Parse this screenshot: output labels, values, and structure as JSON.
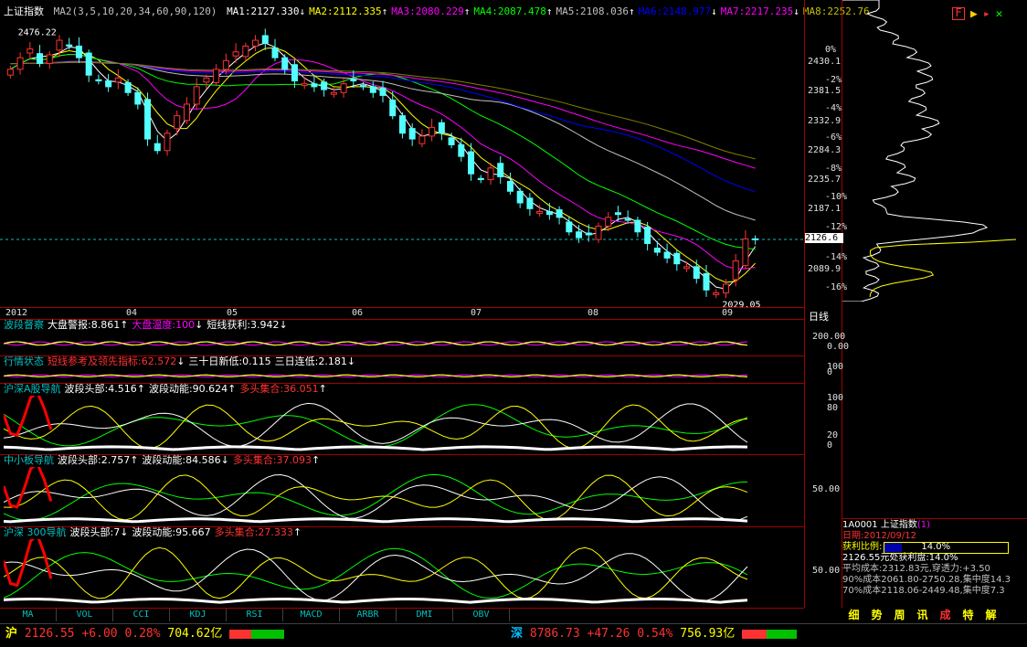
{
  "colors": {
    "up": "#ff3232",
    "down": "#54ffff",
    "ma1": "#ffffff",
    "ma2": "#ffff00",
    "ma3": "#ff00ff",
    "ma4": "#00ff00",
    "ma5": "#c0c0c0",
    "ma6": "#0000ff",
    "ma7": "#ff00ff",
    "ma8": "#808000"
  },
  "header": {
    "title": "上证指数",
    "ma_params": "MA2(3,5,10,20,34,60,90,120)",
    "ma": [
      {
        "label": "MA1:2127.330",
        "arrow": "↓",
        "color": "#ffffff"
      },
      {
        "label": "MA2:2112.335",
        "arrow": "↑",
        "color": "#ffff00"
      },
      {
        "label": "MA3:2080.229",
        "arrow": "↑",
        "color": "#ff00ff"
      },
      {
        "label": "MA4:2087.478",
        "arrow": "↑",
        "color": "#00ff00"
      },
      {
        "label": "MA5:2108.036",
        "arrow": "↑",
        "color": "#c0c0c0"
      },
      {
        "label": "MA6:2148.977",
        "arrow": "↓",
        "color": "#0000ff"
      },
      {
        "label": "MA7:2217.235",
        "arrow": "↓",
        "color": "#ff00ff"
      },
      {
        "label": "MA8:2252.76",
        "arrow": "",
        "color": "#c0c000"
      }
    ]
  },
  "chart_data": {
    "type": "candlestick",
    "title": "上证指数",
    "high_label": "2476.22",
    "low_label": "2029.05",
    "last_price": "2126.6",
    "ylim": [
      2020,
      2500
    ],
    "y_ticks": [
      "2430.1",
      "2381.5",
      "2332.9",
      "2284.3",
      "2235.7",
      "2187.1",
      "2089.9"
    ],
    "pct_ticks": [
      "0%",
      "-2%",
      "-4%",
      "-6%",
      "-8%",
      "-10%",
      "-12%",
      "-14%",
      "-16%"
    ],
    "x_labels": [
      "2012",
      "04",
      "05",
      "06",
      "07",
      "08",
      "09"
    ],
    "period": "日线",
    "series_close": [
      2420,
      2440,
      2455,
      2430,
      2445,
      2470,
      2460,
      2440,
      2410,
      2400,
      2390,
      2405,
      2380,
      2360,
      2300,
      2280,
      2310,
      2340,
      2360,
      2390,
      2405,
      2420,
      2435,
      2450,
      2460,
      2470,
      2465,
      2440,
      2420,
      2400,
      2395,
      2390,
      2385,
      2380,
      2395,
      2400,
      2390,
      2380,
      2375,
      2340,
      2310,
      2300,
      2305,
      2320,
      2310,
      2290,
      2270,
      2240,
      2230,
      2250,
      2235,
      2210,
      2190,
      2180,
      2175,
      2170,
      2165,
      2140,
      2130,
      2135,
      2150,
      2165,
      2170,
      2160,
      2140,
      2120,
      2105,
      2095,
      2085,
      2080,
      2060,
      2040,
      2035,
      2050,
      2090,
      2128,
      2127
    ]
  },
  "indicators": [
    {
      "name": "波段督察",
      "items": [
        {
          "label": "大盘警报:8.861",
          "arrow": "↑",
          "color": "#ffffff"
        },
        {
          "label": "大盘温度:100",
          "arrow": "↓",
          "color": "#ff00ff"
        },
        {
          "label": "短线获利:3.942",
          "arrow": "↓",
          "color": "#ffffff"
        }
      ],
      "ticks": [
        "200.00",
        "0.00"
      ]
    },
    {
      "name": "行情状态",
      "items": [
        {
          "label": "短线参考及领先指标:62.572",
          "arrow": "↓",
          "color": "#ff3232"
        },
        {
          "label": "三十日新低:0.115",
          "arrow": "",
          "color": "#ffffff"
        },
        {
          "label": "三日连低:2.181",
          "arrow": "↓",
          "color": "#ffffff"
        }
      ],
      "ticks": [
        "100",
        "0"
      ]
    },
    {
      "name": "沪深A股导航",
      "items": [
        {
          "label": "波段头部:4.516",
          "arrow": "↑",
          "color": "#ffffff"
        },
        {
          "label": "波段动能:90.624",
          "arrow": "↑",
          "color": "#ffffff"
        },
        {
          "label": "多头集合:36.051",
          "arrow": "↑",
          "color": "#ff3232"
        }
      ],
      "ticks": [
        "100",
        "80",
        "20",
        "0"
      ]
    },
    {
      "name": "中小板导航",
      "items": [
        {
          "label": "波段头部:2.757",
          "arrow": "↑",
          "color": "#ffffff"
        },
        {
          "label": "波段动能:84.586",
          "arrow": "↓",
          "color": "#ffffff"
        },
        {
          "label": "多头集合:37.093",
          "arrow": "↑",
          "color": "#ff3232"
        }
      ],
      "ticks": [
        "50.00"
      ]
    },
    {
      "name": "沪深 300导航",
      "items": [
        {
          "label": "波段头部:7",
          "arrow": "↓",
          "color": "#ffffff"
        },
        {
          "label": "波段动能:95.667",
          "arrow": "",
          "color": "#ffffff"
        },
        {
          "label": "多头集合:27.333",
          "arrow": "↑",
          "color": "#ff3232"
        }
      ],
      "ticks": [
        "50.00"
      ]
    }
  ],
  "bottom_tabs": [
    "MA",
    "VOL",
    "CCI",
    "KDJ",
    "RSI",
    "MACD",
    "ARBR",
    "DMI",
    "OBV"
  ],
  "right_info": {
    "code_name": "1A0001 上证指数",
    "code_suffix": "(1)",
    "date": "日期:2012/09/12",
    "profit_label": "获利比例:",
    "profit_value": "14.0%",
    "lines": [
      "2126.55元处获利盘:14.0%",
      "平均成本:2312.83元,穿透力:+3.50",
      "90%成本2061.80-2750.28,集中度14.3",
      "70%成本2118.06-2449.48,集中度7.3"
    ]
  },
  "right_tabs": [
    "细",
    "势",
    "周",
    "讯",
    "成",
    "特",
    "解"
  ],
  "status": {
    "sh_label": "沪",
    "sh_price": "2126.55",
    "sh_change": "+6.00",
    "sh_pct": "0.28%",
    "sh_amount": "704.62亿",
    "sz_label": "深",
    "sz_price": "8786.73",
    "sz_change": "+47.26",
    "sz_pct": "0.54%",
    "sz_amount": "756.93亿"
  }
}
